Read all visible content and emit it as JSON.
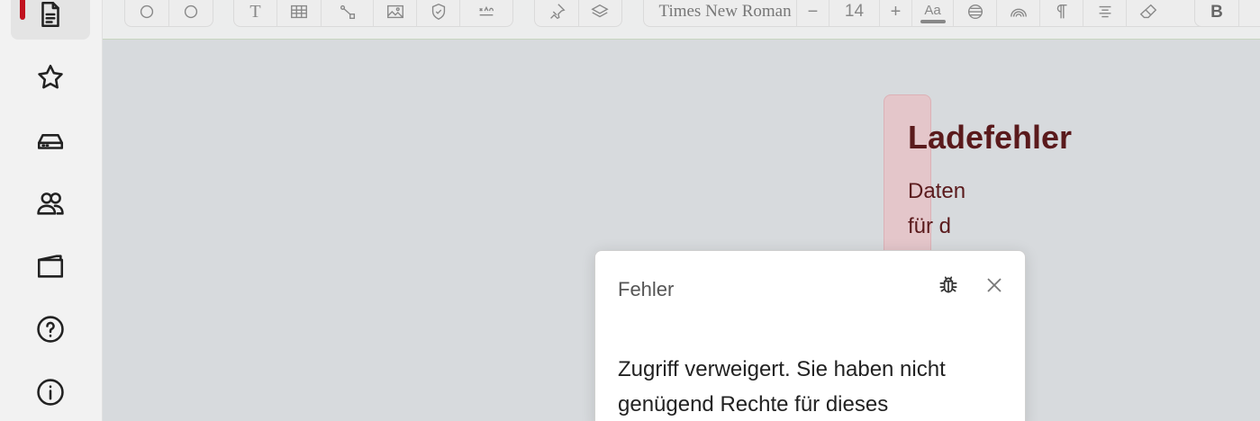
{
  "sidebar": {
    "items": [
      {
        "name": "document-icon",
        "active": true
      },
      {
        "name": "star-icon"
      },
      {
        "name": "drive-icon"
      },
      {
        "name": "users-icon"
      },
      {
        "name": "folder-icon"
      },
      {
        "name": "help-icon"
      },
      {
        "name": "info-icon"
      }
    ],
    "accent_color": "#c1121f"
  },
  "toolbar": {
    "font_name": "Times New Roman",
    "font_size": "14",
    "decrease_label": "−",
    "increase_label": "+",
    "text_style_label": "Aa",
    "text_tool_label": "T",
    "bold_label": "B"
  },
  "canvas": {
    "error_title": "Ladefehler",
    "error_body": "Daten für d"
  },
  "dialog": {
    "title": "Fehler",
    "message": "Zugriff verweigert. Sie haben nicht genügend Rechte für dieses",
    "bug_icon": "bug-icon",
    "close_icon": "close-icon"
  }
}
